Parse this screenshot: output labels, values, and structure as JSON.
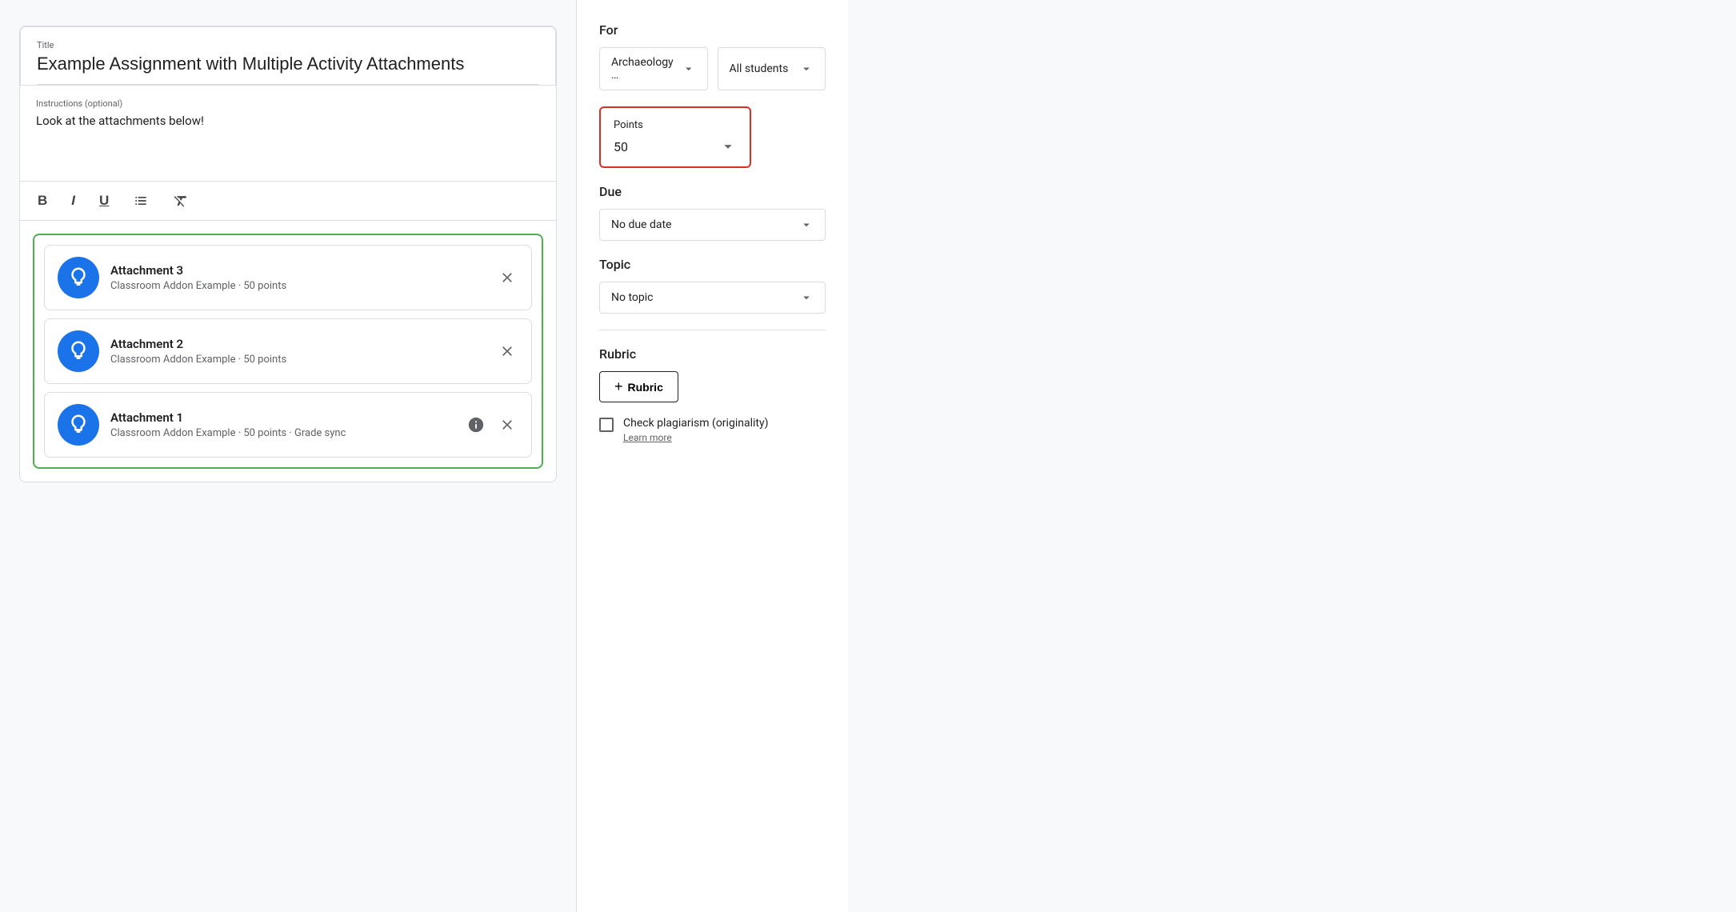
{
  "title_section": {
    "label": "Title",
    "value": "Example Assignment with Multiple Activity Attachments"
  },
  "instructions_section": {
    "label": "Instructions (optional)",
    "value": "Look at the attachments below!"
  },
  "toolbar": {
    "bold": "B",
    "italic": "I",
    "underline": "U",
    "list": "☰",
    "clear": "✕"
  },
  "attachments": [
    {
      "name": "Attachment 3",
      "meta": "Classroom Addon Example · 50 points",
      "has_info": false
    },
    {
      "name": "Attachment 2",
      "meta": "Classroom Addon Example · 50 points",
      "has_info": false
    },
    {
      "name": "Attachment 1",
      "meta": "Classroom Addon Example · 50 points · Grade sync",
      "has_info": true
    }
  ],
  "right_panel": {
    "for_label": "For",
    "course_value": "Archaeology …",
    "students_value": "All students",
    "points_label": "Points",
    "points_value": "50",
    "due_label": "Due",
    "due_value": "No due date",
    "topic_label": "Topic",
    "topic_value": "No topic",
    "rubric_label": "Rubric",
    "rubric_btn_label": "Rubric",
    "plagiarism_label": "Check plagiarism (originality)",
    "learn_more": "Learn more"
  }
}
